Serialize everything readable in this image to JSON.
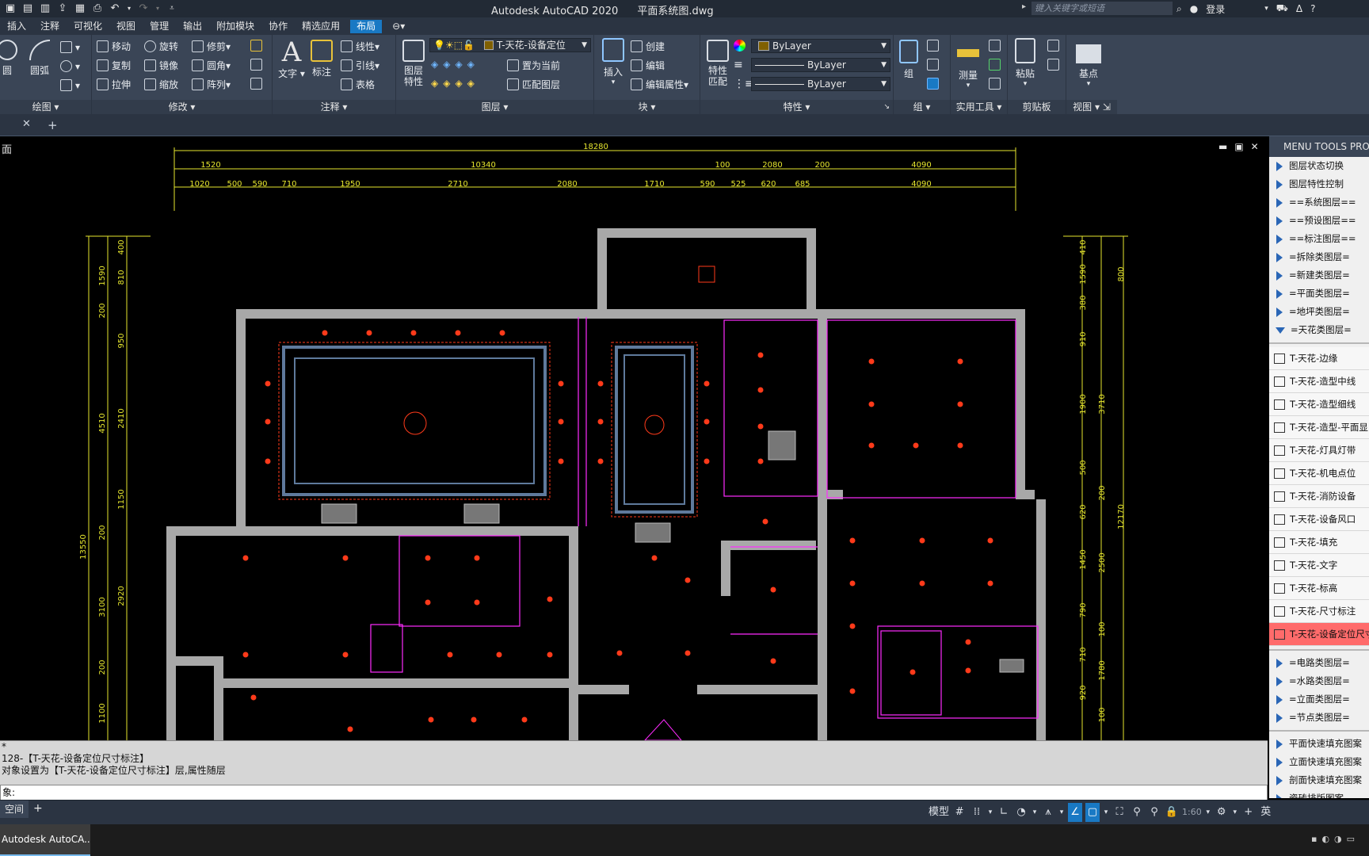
{
  "window": {
    "app_title": "Autodesk AutoCAD 2020",
    "file_name": "平面系统图.dwg",
    "search_placeholder": "键入关键字或短语",
    "login_label": "登录"
  },
  "menu_tabs": [
    "插入",
    "注释",
    "可视化",
    "视图",
    "管理",
    "输出",
    "附加模块",
    "协作",
    "精选应用",
    "布局"
  ],
  "active_tab": "布局",
  "ribbon": {
    "draw": {
      "circle": "圆",
      "arc": "圆弧",
      "title": "绘图"
    },
    "modify": {
      "move": "移动",
      "rotate": "旋转",
      "trim": "修剪",
      "copy": "复制",
      "mirror": "镜像",
      "fillet": "圆角",
      "stretch": "拉伸",
      "scale": "缩放",
      "array": "阵列",
      "title": "修改"
    },
    "annotation": {
      "text": "文字",
      "dimension": "标注",
      "linear": "线性",
      "leader": "引线",
      "table": "表格",
      "title": "注释"
    },
    "layers": {
      "layer_props": "图层\n特性",
      "current_layer": "T-天花-设备定位",
      "set_current": "置为当前",
      "match_layer": "匹配图层",
      "title": "图层"
    },
    "block": {
      "insert": "插入",
      "create": "创建",
      "edit": "编辑",
      "edit_attr": "编辑属性",
      "title": "块"
    },
    "properties": {
      "match": "特性\n匹配",
      "color": "ByLayer",
      "linetype": "ByLayer",
      "lineweight": "ByLayer",
      "title": "特性"
    },
    "groups": {
      "group": "组",
      "title": "组"
    },
    "utilities": {
      "measure": "测量",
      "title": "实用工具"
    },
    "clipboard": {
      "paste": "粘贴",
      "title": "剪贴板"
    },
    "view": {
      "base": "基点",
      "title": "视图"
    }
  },
  "viewport_label": "面",
  "drawing": {
    "dim_total_top": "18280",
    "dims_row1": [
      "1520",
      "10340",
      "100",
      "2080",
      "200",
      "4090"
    ],
    "dims_row2": [
      "1020",
      "500",
      "590",
      "710",
      "1950",
      "2710",
      "2080",
      "1710",
      "590",
      "525",
      "620",
      "685",
      "4090"
    ],
    "dims_left_outer": [
      "400",
      "1590",
      "810",
      "200",
      "950",
      "4510",
      "2410",
      "1150",
      "200",
      "13550",
      "3100",
      "2920",
      "200",
      "1100"
    ],
    "dims_right": [
      "410",
      "1590",
      "800",
      "380",
      "910",
      "3710",
      "1900",
      "200",
      "500",
      "620",
      "1450",
      "2500",
      "12170",
      "790",
      "100",
      "1780",
      "710",
      "920",
      "100"
    ]
  },
  "palette": {
    "header": "MENU TOOLS PRO",
    "groups_top": [
      "图层状态切换",
      "图层特性控制",
      "==系统图层==",
      "==预设图层==",
      "==标注图层==",
      "=拆除类图层=",
      "=新建类图层=",
      "=平面类图层=",
      "=地坪类图层="
    ],
    "expanded_group": "=天花类图层=",
    "layers": [
      "T-天花-边缘",
      "T-天花-造型中线",
      "T-天花-造型细线",
      "T-天花-造型-平面显",
      "T-天花-灯具灯带",
      "T-天花-机电点位",
      "T-天花-消防设备",
      "T-天花-设备风口",
      "T-天花-填充",
      "T-天花-文字",
      "T-天花-标高",
      "T-天花-尺寸标注",
      "T-天花-设备定位尺寸"
    ],
    "highlighted_layer": "T-天花-设备定位尺寸",
    "groups_bottom": [
      "=电路类图层=",
      "=水路类图层=",
      "=立面类图层=",
      "=节点类图层="
    ],
    "tools": [
      "平面快速填充图案",
      "立面快速填充图案",
      "剖面快速填充图案",
      "瓷砖排版图案"
    ]
  },
  "command_line": {
    "line1": "*",
    "line2": "128-【T-天花-设备定位尺寸标注】",
    "line3": "对象设置为【T-天花-设备定位尺寸标注】层,属性随层",
    "prompt": "象:"
  },
  "status_bar": {
    "space_label": "空间",
    "model_label": "模型",
    "scale": "1:60",
    "ime": "英"
  },
  "taskbar": {
    "app": "Autodesk AutoCA..."
  },
  "colors": {
    "accent": "#1979c4",
    "ribbon_bg": "#3a4556",
    "wall": "#a8a8a8",
    "lights": "#ff3a1a",
    "dims": "#e6e62e",
    "highlight": "#ff6b6b"
  }
}
